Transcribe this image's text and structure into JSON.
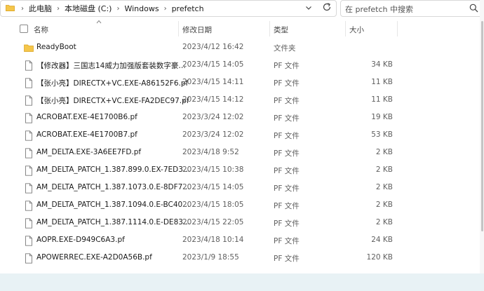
{
  "address": {
    "crumbs": [
      "此电脑",
      "本地磁盘 (C:)",
      "Windows",
      "prefetch"
    ],
    "separator": "›",
    "dropdown_icon": "chevron-down-icon",
    "refresh_icon": "refresh-icon"
  },
  "search": {
    "placeholder": "在 prefetch 中搜索",
    "icon": "search-icon"
  },
  "columns": {
    "name": "名称",
    "date": "修改日期",
    "type": "类型",
    "size": "大小"
  },
  "files": [
    {
      "name": "ReadyBoot",
      "date": "2023/4/12 16:42",
      "type": "文件夹",
      "size": "",
      "icon": "folder-icon"
    },
    {
      "name": "【修改器】三国志14威力加强版套装数字豪…",
      "date": "2023/4/15 14:05",
      "type": "PF 文件",
      "size": "34 KB",
      "icon": "file-icon"
    },
    {
      "name": "【张小亮】DIRECTX+VC.EXE-A86152F6.pf",
      "date": "2023/4/15 14:11",
      "type": "PF 文件",
      "size": "11 KB",
      "icon": "file-icon"
    },
    {
      "name": "【张小亮】DIRECTX+VC.EXE-FA2DEC97.pf",
      "date": "2023/4/15 14:12",
      "type": "PF 文件",
      "size": "11 KB",
      "icon": "file-icon"
    },
    {
      "name": "ACROBAT.EXE-4E1700B6.pf",
      "date": "2023/3/24 12:02",
      "type": "PF 文件",
      "size": "19 KB",
      "icon": "file-icon"
    },
    {
      "name": "ACROBAT.EXE-4E1700B7.pf",
      "date": "2023/3/24 12:02",
      "type": "PF 文件",
      "size": "53 KB",
      "icon": "file-icon"
    },
    {
      "name": "AM_DELTA.EXE-3A6EE7FD.pf",
      "date": "2023/4/18 9:52",
      "type": "PF 文件",
      "size": "2 KB",
      "icon": "file-icon"
    },
    {
      "name": "AM_DELTA_PATCH_1.387.899.0.EX-7ED3…",
      "date": "2023/4/15 10:38",
      "type": "PF 文件",
      "size": "2 KB",
      "icon": "file-icon"
    },
    {
      "name": "AM_DELTA_PATCH_1.387.1073.0.E-8DF7…",
      "date": "2023/4/15 14:05",
      "type": "PF 文件",
      "size": "2 KB",
      "icon": "file-icon"
    },
    {
      "name": "AM_DELTA_PATCH_1.387.1094.0.E-BC40…",
      "date": "2023/4/15 18:05",
      "type": "PF 文件",
      "size": "2 KB",
      "icon": "file-icon"
    },
    {
      "name": "AM_DELTA_PATCH_1.387.1114.0.E-DE83…",
      "date": "2023/4/15 22:05",
      "type": "PF 文件",
      "size": "2 KB",
      "icon": "file-icon"
    },
    {
      "name": "AOPR.EXE-D949C6A3.pf",
      "date": "2023/4/18 10:14",
      "type": "PF 文件",
      "size": "24 KB",
      "icon": "file-icon"
    },
    {
      "name": "APOWERREC.EXE-A2D0A56B.pf",
      "date": "2023/1/9 18:55",
      "type": "PF 文件",
      "size": "120 KB",
      "icon": "file-icon"
    }
  ],
  "colors": {
    "folder": "#f5c64a",
    "background": "#e8f2f5"
  }
}
